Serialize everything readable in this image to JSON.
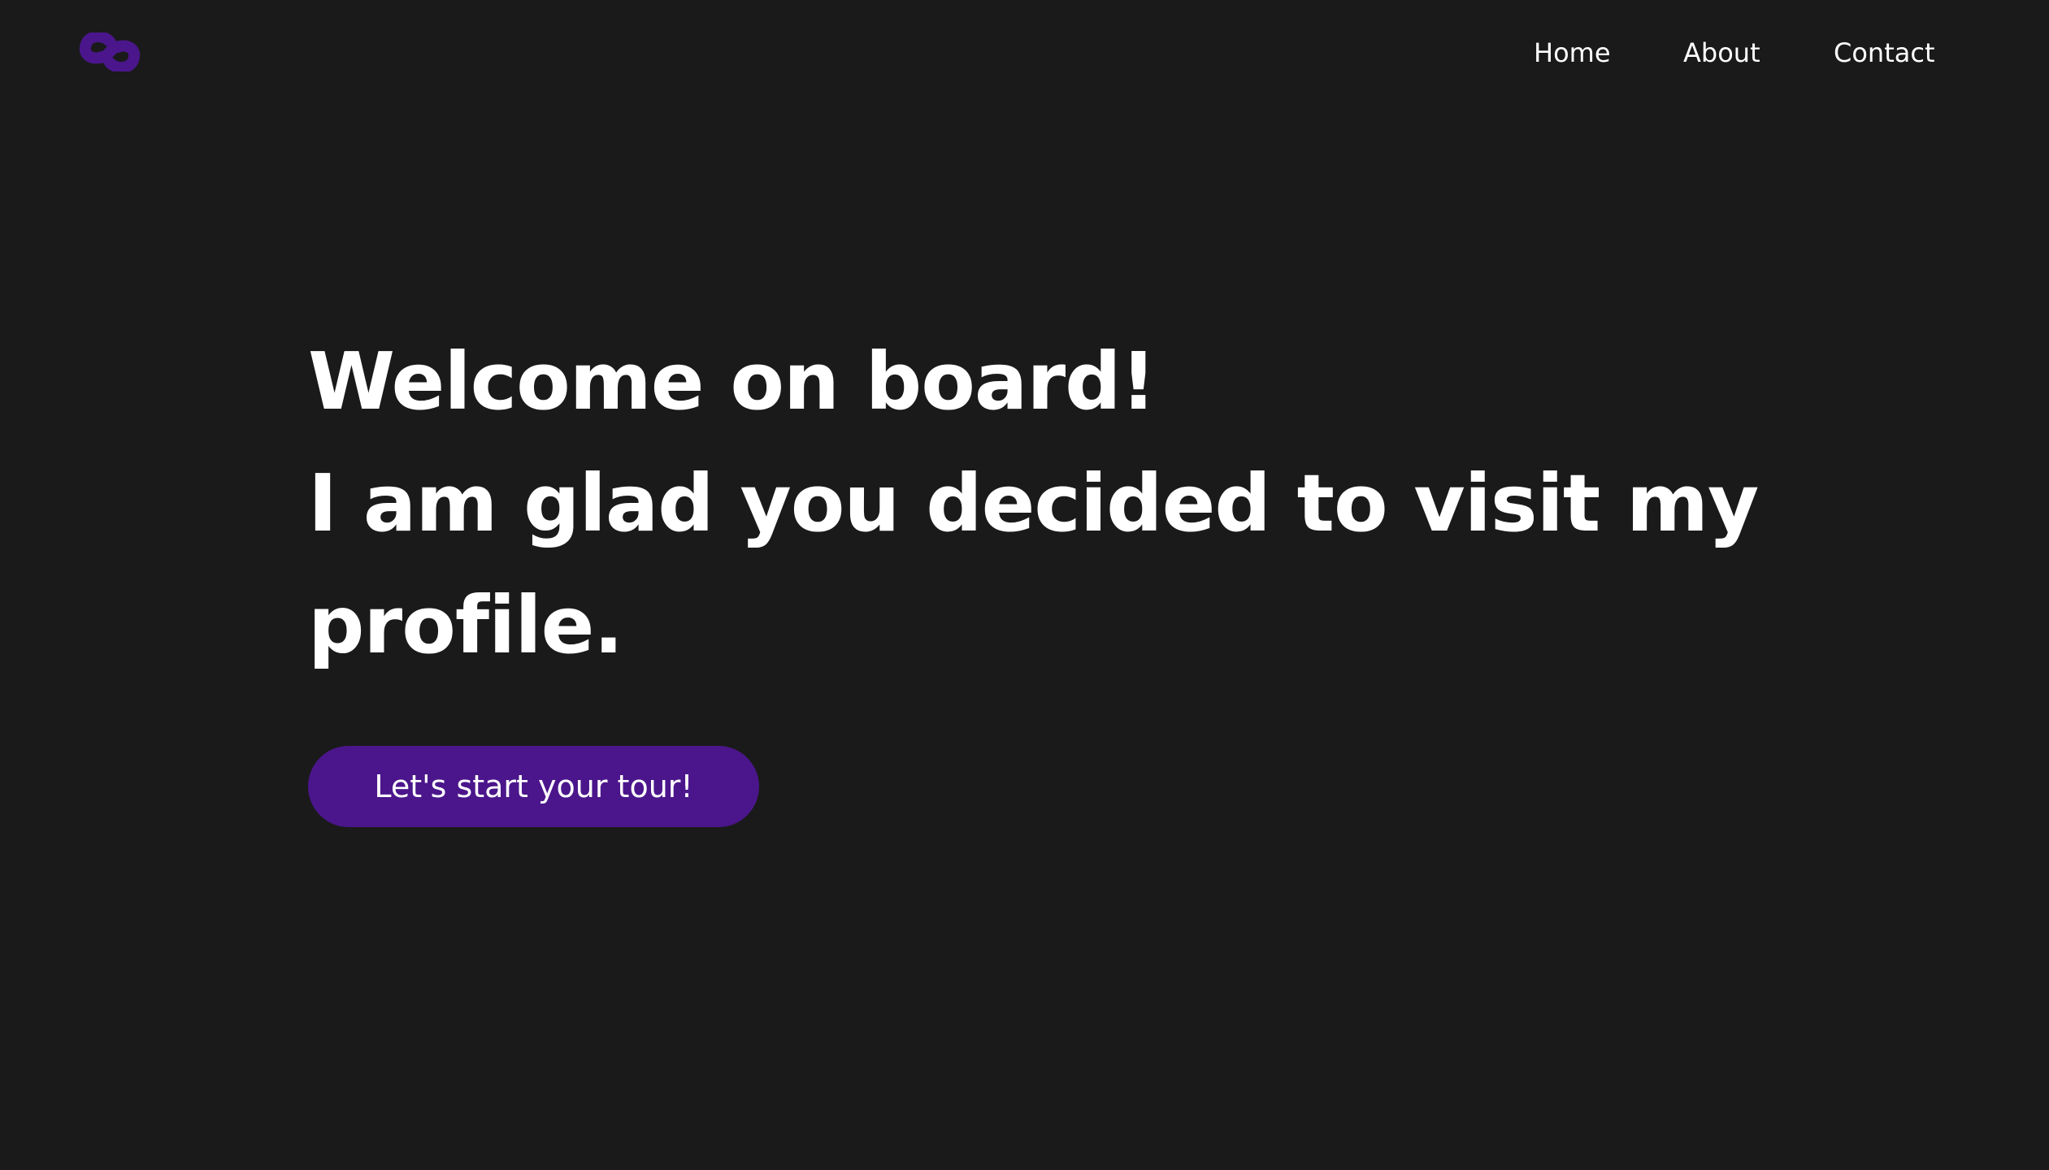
{
  "header": {
    "logo_icon": "s-link-logo-icon",
    "accent_color": "#4b168b",
    "nav": {
      "home": "Home",
      "about": "About",
      "contact": "Contact"
    }
  },
  "hero": {
    "line1": "Welcome on board!",
    "line2": "I am glad you decided to visit my",
    "line3": "profile.",
    "cta_label": "Let's start your tour!"
  },
  "colors": {
    "background": "#1a1a1b",
    "text": "#ffffff",
    "button": "#4b168b"
  }
}
